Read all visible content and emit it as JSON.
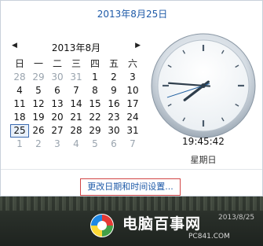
{
  "flyout": {
    "date_header": "2013年8月25日",
    "time": "19:45:42",
    "weekday": "星期日",
    "settings_link": "更改日期和时间设置..."
  },
  "calendar": {
    "month_title": "2013年8月",
    "prev_icon": "triangle-left-icon",
    "next_icon": "triangle-right-icon",
    "weekdays": [
      "日",
      "一",
      "二",
      "三",
      "四",
      "五",
      "六"
    ],
    "weeks": [
      [
        {
          "d": "28",
          "o": true
        },
        {
          "d": "29",
          "o": true
        },
        {
          "d": "30",
          "o": true
        },
        {
          "d": "31",
          "o": true
        },
        {
          "d": "1"
        },
        {
          "d": "2"
        },
        {
          "d": "3"
        }
      ],
      [
        {
          "d": "4"
        },
        {
          "d": "5"
        },
        {
          "d": "6"
        },
        {
          "d": "7"
        },
        {
          "d": "8"
        },
        {
          "d": "9"
        },
        {
          "d": "10"
        }
      ],
      [
        {
          "d": "11"
        },
        {
          "d": "12"
        },
        {
          "d": "13"
        },
        {
          "d": "14"
        },
        {
          "d": "15"
        },
        {
          "d": "16"
        },
        {
          "d": "17"
        }
      ],
      [
        {
          "d": "18"
        },
        {
          "d": "19"
        },
        {
          "d": "20"
        },
        {
          "d": "21"
        },
        {
          "d": "22"
        },
        {
          "d": "23"
        },
        {
          "d": "24"
        }
      ],
      [
        {
          "d": "25",
          "t": true
        },
        {
          "d": "26"
        },
        {
          "d": "27"
        },
        {
          "d": "28"
        },
        {
          "d": "29"
        },
        {
          "d": "30"
        },
        {
          "d": "31"
        }
      ],
      [
        {
          "d": "1",
          "o": true
        },
        {
          "d": "2",
          "o": true
        },
        {
          "d": "3",
          "o": true
        },
        {
          "d": "4",
          "o": true
        },
        {
          "d": "5",
          "o": true
        },
        {
          "d": "6",
          "o": true
        },
        {
          "d": "7",
          "o": true
        }
      ]
    ]
  },
  "clock": {
    "hour": 19,
    "minute": 45,
    "second": 42,
    "icon": "analog-clock-icon"
  },
  "watermark": {
    "main": "电脑百事网",
    "sub": "PC841.COM",
    "date": "2013/8/25",
    "logo_icon": "pc841-logo-icon"
  },
  "colors": {
    "accent": "#1e5aa8",
    "highlight_border": "#d24545"
  }
}
